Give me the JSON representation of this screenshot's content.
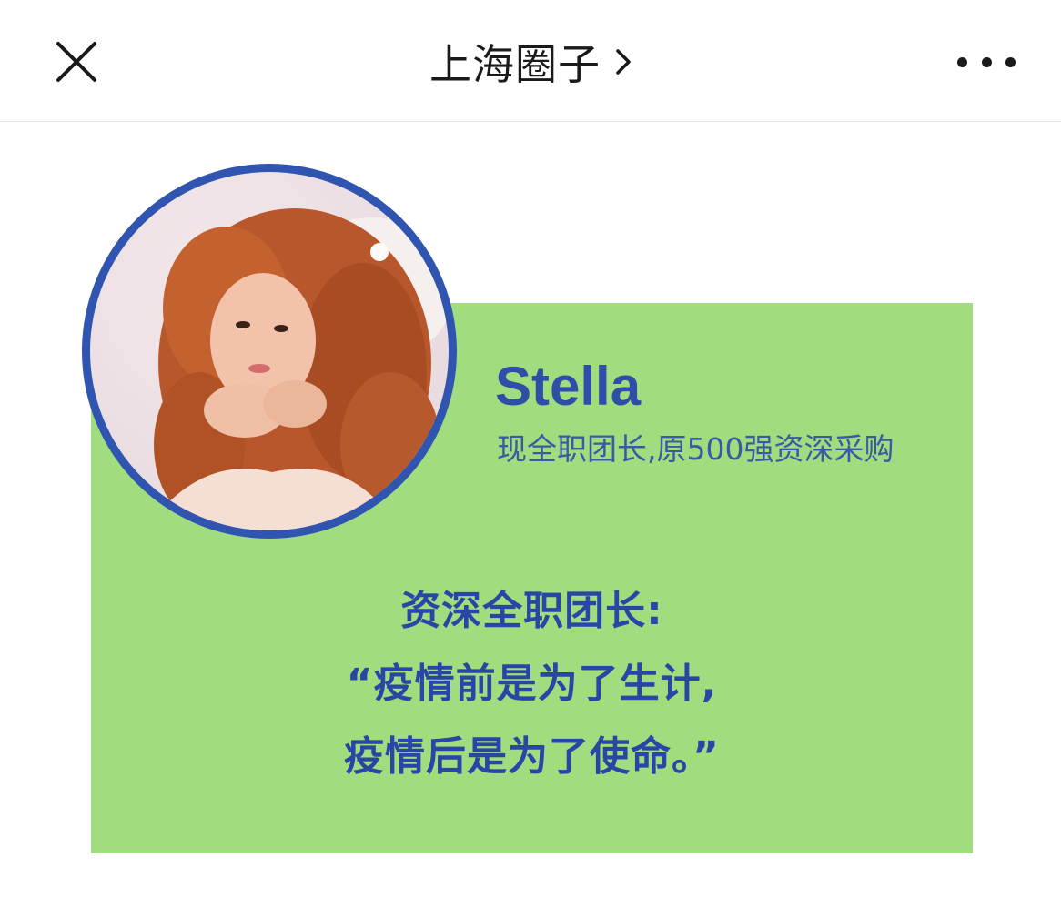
{
  "navbar": {
    "title": "上海圈子",
    "close_icon": "close-icon",
    "chevron_icon": "chevron-right-icon",
    "more_icon": "more-dots-icon"
  },
  "card": {
    "name": "Stella",
    "subtitle": "现全职团长,原500强资深采购",
    "quote_lines": [
      "资深全职团长:",
      "“疫情前是为了生计,",
      "疫情后是为了使命。”"
    ],
    "colors": {
      "background": "#a1dc7e",
      "ring": "#2f55b0",
      "text": "#2747a6"
    }
  }
}
